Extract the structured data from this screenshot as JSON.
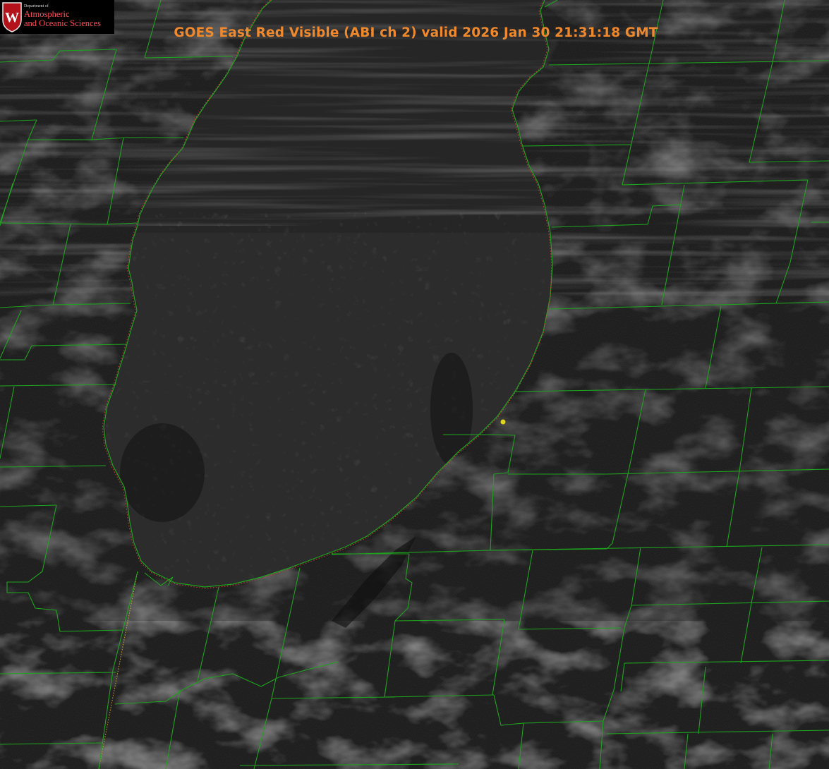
{
  "title": "GOES East Red Visible (ABI ch 2) valid 2026 Jan 30 21:31:18 GMT",
  "logo": {
    "department": "Department of",
    "line1": "Atmospheric",
    "line2": "and Oceanic Sciences",
    "crest_letter": "W"
  },
  "colors": {
    "county_lines": "#1fa31f",
    "shoreline": "#d23a3a",
    "title_text": "#f0882c",
    "logo_text": "#ff4d55",
    "logo_crest": "#b3121b",
    "station_marker": "#e2d61c",
    "imagery_base": "#1a1a1a"
  },
  "map": {
    "channel": "ABI ch 2",
    "satellite": "GOES East",
    "product": "Red Visible"
  }
}
